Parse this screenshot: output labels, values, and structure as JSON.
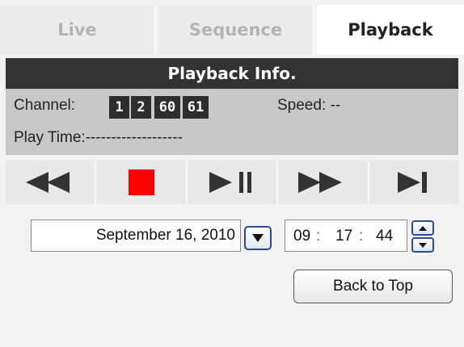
{
  "tabs": {
    "live": "Live",
    "sequence": "Sequence",
    "playback": "Playback",
    "active": "Playback"
  },
  "info": {
    "title": "Playback Info.",
    "channel_label": "Channel:",
    "channels": [
      "1",
      "2",
      "60",
      "61"
    ],
    "speed_label": "Speed: --",
    "play_time_label": "Play Time:-------------------"
  },
  "controls": {
    "icons": [
      "rewind-icon",
      "stop-icon",
      "play-pause-icon",
      "fast-forward-icon",
      "skip-to-end-icon"
    ],
    "accent_color": "#ff0000",
    "icon_color": "#333333"
  },
  "date": {
    "value": "September 16, 2010"
  },
  "time": {
    "hour": "09",
    "minute": "17",
    "second": "44",
    "separator": ":"
  },
  "back_button": {
    "label": "Back to Top"
  }
}
